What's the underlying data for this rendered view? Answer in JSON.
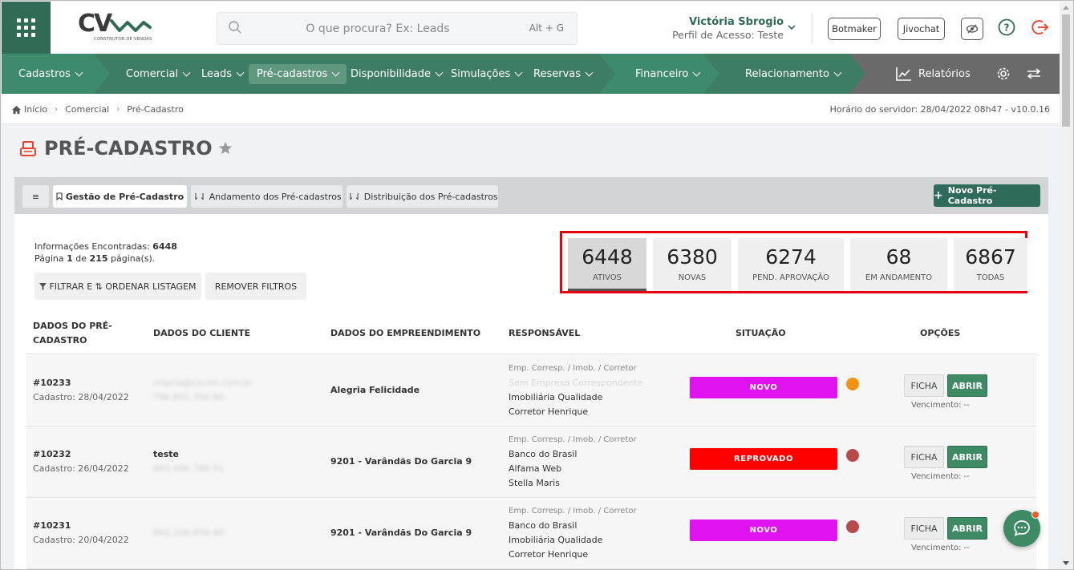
{
  "brand": {
    "logo_text": "CV",
    "logo_sub": "CONSTRUTOR DE VENDAS"
  },
  "search": {
    "placeholder": "O que procura? Ex: Leads",
    "shortcut": "Alt + G"
  },
  "user": {
    "name": "Victória Sbrogio",
    "role": "Perfil de Acesso: Teste"
  },
  "top_buttons": {
    "botmaker": "Botmaker",
    "jivochat": "Jivochat"
  },
  "nav": {
    "items": [
      {
        "label": "Cadastros"
      },
      {
        "label": "Comercial"
      },
      {
        "label": "Leads"
      },
      {
        "label": "Pré-cadastros"
      },
      {
        "label": "Disponibilidade"
      },
      {
        "label": "Simulações"
      },
      {
        "label": "Reservas"
      },
      {
        "label": "Financeiro"
      },
      {
        "label": "Relacionamento"
      }
    ],
    "reports": "Relatórios"
  },
  "breadcrumb": {
    "items": [
      "Início",
      "Comercial",
      "Pré-Cadastro"
    ],
    "server_time": "Horário do servidor: 28/04/2022 08h47 - v10.0.16"
  },
  "page": {
    "title": "PRÉ-CADASTRO"
  },
  "tabs": {
    "menu": "≡",
    "items": [
      {
        "label": "Gestão de Pré-Cadastro"
      },
      {
        "label": "Andamento dos Pré-cadastros"
      },
      {
        "label": "Distribuição dos Pré-cadastros"
      }
    ],
    "new_button": "Novo Pré-Cadastro"
  },
  "info": {
    "found_label": "Informações Encontradas:",
    "found_value": "6448",
    "page_prefix": "Página",
    "page_current": "1",
    "page_mid": "de",
    "page_total": "215",
    "page_suffix": "página(s)."
  },
  "filters": {
    "filter_order": "FILTRAR E ⇅ ORDENAR LISTAGEM",
    "remove": "REMOVER FILTROS"
  },
  "stats": [
    {
      "value": "6448",
      "label": "ATIVOS",
      "active": true
    },
    {
      "value": "6380",
      "label": "NOVAS"
    },
    {
      "value": "6274",
      "label": "PEND. APROVAÇÃO"
    },
    {
      "value": "68",
      "label": "EM ANDAMENTO"
    },
    {
      "value": "6867",
      "label": "TODAS"
    }
  ],
  "table": {
    "headers": [
      "DADOS DO PRÉ-\nCADASTRO",
      "DADOS DO CLIENTE",
      "DADOS DO EMPREENDIMENTO",
      "RESPONSÁVEL",
      "SITUAÇÃO",
      "OPÇÕES"
    ],
    "rows": [
      {
        "id": "#10233",
        "date": "Cadastro: 28/04/2022",
        "client_name": "",
        "client_line1": "rcterra@cvcrm.com.br",
        "client_line2": "796.651.350-60",
        "project": "Alegria Felicidade",
        "resp_header": "Emp. Corresp. / Imob. / Corretor",
        "resp_line1": "Sem Empresa Correspondente",
        "resp_line2": "Imobiliária Qualidade",
        "resp_line3": "Corretor Henrique",
        "status": "NOVO",
        "status_color": "#e012f0",
        "dot_color": "#f0920f",
        "ficha": "FICHA",
        "abrir": "ABRIR",
        "venc": "Vencimento: --"
      },
      {
        "id": "#10232",
        "date": "Cadastro: 26/04/2022",
        "client_name": "teste",
        "client_line1": "683.496.780-51",
        "client_line2": "",
        "project": "9201 - Varândãs Do Garcia 9",
        "resp_header": "Emp. Corresp. / Imob. / Corretor",
        "resp_line1": "Banco do Brasil",
        "resp_line2": "Alfama Web",
        "resp_line3": "Stella Maris",
        "status": "REPROVADO",
        "status_color": "#ff0000",
        "dot_color": "#b84a4a",
        "ficha": "FICHA",
        "abrir": "ABRIR",
        "venc": "Vencimento: --"
      },
      {
        "id": "#10231",
        "date": "Cadastro: 20/04/2022",
        "client_name": "",
        "client_line1": "602.226.658-40",
        "client_line2": "",
        "project": "9201 - Varândãs Do Garcia 9",
        "resp_header": "Emp. Corresp. / Imob. / Corretor",
        "resp_line1": "Banco do Brasil",
        "resp_line2": "Imobiliária Qualidade",
        "resp_line3": "Corretor Henrique",
        "status": "NOVO",
        "status_color": "#e012f0",
        "dot_color": "#b84a4a",
        "ficha": "FICHA",
        "abrir": "ABRIR",
        "venc": "Vencimento: --"
      }
    ]
  },
  "colors": {
    "brand_green": "#3d7d64",
    "dark_green": "#2f6b55",
    "highlight_red": "#e8000b"
  },
  "icons": [
    "apps-grid-icon",
    "search-icon",
    "chevron-down-icon",
    "eye-off-icon",
    "help-icon",
    "logout-icon",
    "chart-icon",
    "gear-icon",
    "swap-icon",
    "home-icon",
    "register-icon",
    "star-icon",
    "bookmark-icon",
    "sort-icon",
    "filter-icon",
    "plus-icon",
    "chat-icon"
  ]
}
